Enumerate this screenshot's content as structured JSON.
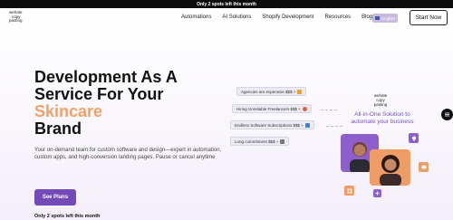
{
  "announcement": {
    "text": "Only 2 spots left this month"
  },
  "logo": {
    "lines": [
      "wehate",
      "copy",
      "pasting"
    ]
  },
  "nav": {
    "items": [
      "Automations",
      "AI Solutions",
      "Shopify Development",
      "Resources",
      "Blog"
    ],
    "language": "English",
    "cta": "Start Now"
  },
  "hero": {
    "headline_line1": "Development As A",
    "headline_line2": "Service For Your",
    "headline_accent": "Skincare",
    "headline_line4": "Brand",
    "subtext": "Your on-demand team for custom software and design—expert in automation, custom apps, and high-conversion landing pages. Pause or cancel anytime",
    "cta": "See Plans",
    "spots": "Only 2 spots left this month"
  },
  "pills": [
    {
      "text": "Agencies are expensive $$$ +",
      "icon": "money-bag-icon"
    },
    {
      "text": "Hiring Unreliable Freelancers $$$ +",
      "icon": "angry-face-icon"
    },
    {
      "text": "Endless Software Subscriptions $$$ +",
      "icon": "check-box-icon"
    },
    {
      "text": "Long commitment $$$ +",
      "icon": "cross-icon"
    }
  ],
  "solution": {
    "logo_lines": [
      "wehate",
      "copy",
      "pasting"
    ],
    "tagline": "All-in-One Solution to automate your business"
  },
  "colors": {
    "accent_purple": "#7449b8",
    "accent_orange": "#f0a167",
    "announcement_bg": "#0d0d0d"
  }
}
